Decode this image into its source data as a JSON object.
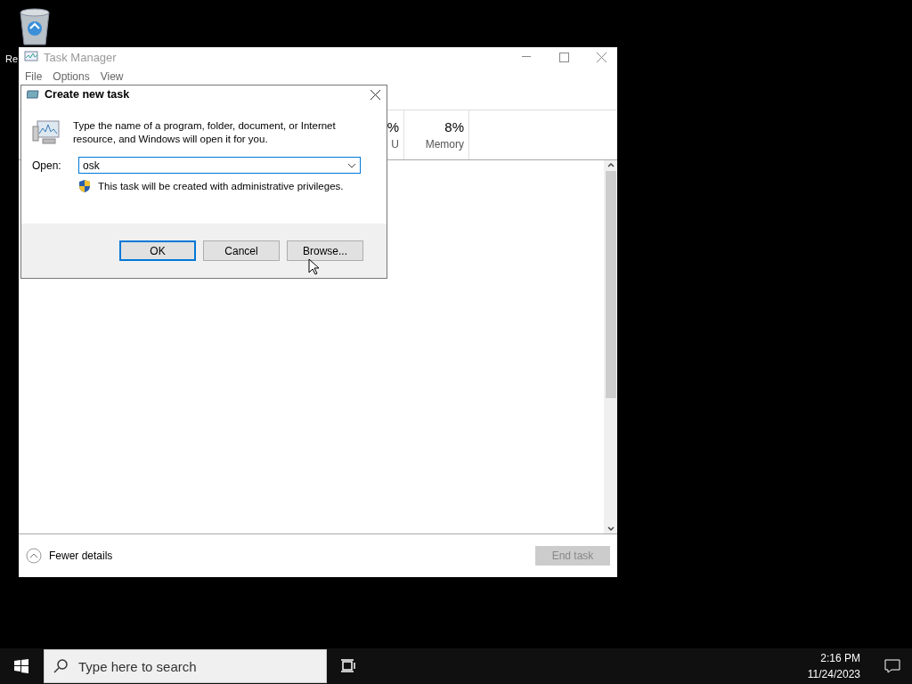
{
  "desktop": {
    "icons": [
      {
        "label": "Re"
      }
    ]
  },
  "task_manager": {
    "title": "Task Manager",
    "menu": [
      "File",
      "Options",
      "View"
    ],
    "columns": [
      {
        "value": "%",
        "label": "U"
      },
      {
        "value": "8%",
        "label": "Memory"
      }
    ],
    "footer": {
      "toggle": "Fewer details",
      "end_task": {
        "label": "End task",
        "disabled": true
      }
    }
  },
  "dialog": {
    "title": "Create new task",
    "message": "Type the name of a program, folder, document, or Internet resource, and Windows will open it for you.",
    "open_label": "Open:",
    "open_value": "osk",
    "note": "This task will be created with administrative privileges.",
    "buttons": [
      {
        "label": "OK",
        "default": true
      },
      {
        "label": "Cancel",
        "default": false
      },
      {
        "label": "Browse...",
        "default": false
      }
    ]
  },
  "taskbar": {
    "search_placeholder": "Type here to search",
    "time": "2:16 PM",
    "date": "11/24/2023"
  }
}
